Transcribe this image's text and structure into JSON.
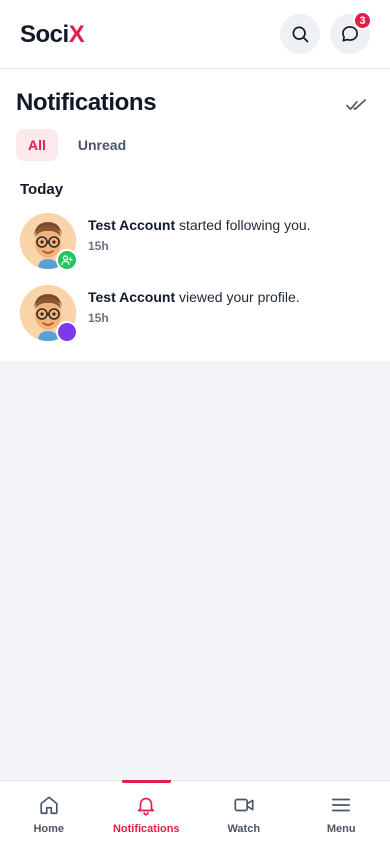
{
  "header": {
    "logo_main": "Soci",
    "logo_accent": "X",
    "messages_badge": "3",
    "search_icon": "search-icon",
    "messages_icon": "chat-bubble-icon"
  },
  "page": {
    "title": "Notifications",
    "mark_read_icon": "double-check-icon",
    "tabs": [
      {
        "label": "All",
        "active": true
      },
      {
        "label": "Unread",
        "active": false
      }
    ],
    "section_heading": "Today"
  },
  "notifications": [
    {
      "actor": "Test Account",
      "action": "started following you.",
      "time": "15h",
      "type_icon": "user-plus-icon"
    },
    {
      "actor": "Test Account",
      "action": "viewed your profile.",
      "time": "15h",
      "type_icon": "eye-icon"
    }
  ],
  "bottom_nav": [
    {
      "label": "Home",
      "icon": "home-icon",
      "active": false
    },
    {
      "label": "Notifications",
      "icon": "bell-icon",
      "active": true
    },
    {
      "label": "Watch",
      "icon": "video-icon",
      "active": false
    },
    {
      "label": "Menu",
      "icon": "menu-icon",
      "active": false
    }
  ],
  "colors": {
    "accent": "#e11d48",
    "follow_badge": "#22c55e",
    "view_badge": "#7c3aed"
  }
}
